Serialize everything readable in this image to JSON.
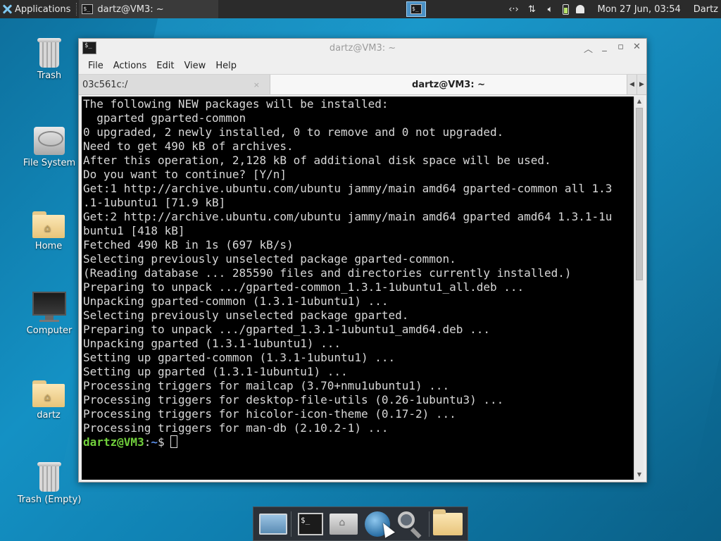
{
  "top_panel": {
    "applications_label": "Applications",
    "task_title": "dartz@VM3: ~",
    "clock": "Mon 27 Jun, 03:54",
    "user": "Dartz",
    "tray_icons": [
      "network-arrows-icon",
      "updown-arrows-icon",
      "volume-icon",
      "battery-icon",
      "notification-bell-icon"
    ]
  },
  "desktop": {
    "icons": [
      {
        "label": "Trash"
      },
      {
        "label": "File System"
      },
      {
        "label": "Home"
      },
      {
        "label": "Computer"
      },
      {
        "label": "dartz"
      },
      {
        "label": "Trash (Empty)"
      }
    ]
  },
  "window": {
    "title": "dartz@VM3: ~",
    "menu": [
      "File",
      "Actions",
      "Edit",
      "View",
      "Help"
    ],
    "tabs": [
      {
        "label": "03c561c:/",
        "close": "×"
      },
      {
        "label": "dartz@VM3: ~"
      }
    ],
    "terminal_lines": [
      "The following NEW packages will be installed:",
      "  gparted gparted-common",
      "0 upgraded, 2 newly installed, 0 to remove and 0 not upgraded.",
      "Need to get 490 kB of archives.",
      "After this operation, 2,128 kB of additional disk space will be used.",
      "Do you want to continue? [Y/n]",
      "Get:1 http://archive.ubuntu.com/ubuntu jammy/main amd64 gparted-common all 1.3",
      ".1-1ubuntu1 [71.9 kB]",
      "Get:2 http://archive.ubuntu.com/ubuntu jammy/main amd64 gparted amd64 1.3.1-1u",
      "buntu1 [418 kB]",
      "Fetched 490 kB in 1s (697 kB/s)",
      "Selecting previously unselected package gparted-common.",
      "(Reading database ... 285590 files and directories currently installed.)",
      "Preparing to unpack .../gparted-common_1.3.1-1ubuntu1_all.deb ...",
      "Unpacking gparted-common (1.3.1-1ubuntu1) ...",
      "Selecting previously unselected package gparted.",
      "Preparing to unpack .../gparted_1.3.1-1ubuntu1_amd64.deb ...",
      "Unpacking gparted (1.3.1-1ubuntu1) ...",
      "Setting up gparted-common (1.3.1-1ubuntu1) ...",
      "Setting up gparted (1.3.1-1ubuntu1) ...",
      "Processing triggers for mailcap (3.70+nmu1ubuntu1) ...",
      "Processing triggers for desktop-file-utils (0.26-1ubuntu3) ...",
      "Processing triggers for hicolor-icon-theme (0.17-2) ...",
      "Processing triggers for man-db (2.10.2-1) ..."
    ],
    "prompt": {
      "user_host": "dartz@VM3",
      "sep": ":",
      "path": "~",
      "symbol": "$"
    }
  },
  "dock": {
    "items": [
      "show-desktop-icon",
      "terminal-icon",
      "file-manager-icon",
      "web-browser-icon",
      "app-finder-icon",
      "folder-icon"
    ]
  },
  "colors": {
    "prompt_user": "#71d03c",
    "prompt_path": "#5b8ee8",
    "panel_bg": "#2b2b2b",
    "terminal_bg": "#000000"
  }
}
